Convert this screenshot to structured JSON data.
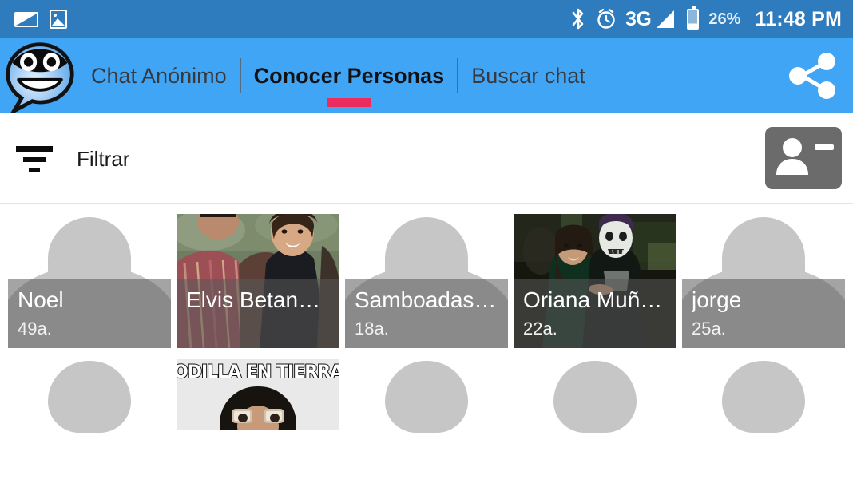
{
  "status_bar": {
    "background_color": "#2e7cbe",
    "left_icons": [
      {
        "name": "battery-notification-icon"
      },
      {
        "name": "screenshot-image-icon"
      }
    ],
    "right_icons": [
      {
        "name": "bluetooth-icon",
        "glyph": "ᛗ"
      },
      {
        "name": "alarm-clock-icon",
        "glyph": "⏱"
      }
    ],
    "network": "3G",
    "battery_percent": "26%",
    "time": "11:48 PM"
  },
  "app_bar": {
    "background_color": "#41a5f5",
    "logo_name": "chat-anonimo-logo",
    "share_icon": "share-icon",
    "indicator_color": "#ec2b5f",
    "tabs": [
      {
        "label": "Chat Anónimo",
        "active": false
      },
      {
        "label": "Conocer Personas",
        "active": true
      },
      {
        "label": "Buscar chat",
        "active": false
      }
    ]
  },
  "filter_bar": {
    "filter_icon": "filter-icon",
    "filter_label": "Filtrar",
    "contacts_button_icon": "contact-card-remove-icon",
    "contacts_button_color": "#6b6b6b"
  },
  "people_grid": {
    "row1": [
      {
        "name": "Noel",
        "age": "49a.",
        "photo": "placeholder"
      },
      {
        "name": "Elvis Betan…",
        "age": "",
        "photo": "couple-man-striped-shirt"
      },
      {
        "name": "Samboadas…",
        "age": "18a.",
        "photo": "placeholder"
      },
      {
        "name": "Oriana Muñ…",
        "age": "22a.",
        "photo": "couple-night-dark"
      },
      {
        "name": "jorge",
        "age": "25a.",
        "photo": "placeholder"
      }
    ],
    "row2": [
      {
        "photo": "placeholder",
        "caption": ""
      },
      {
        "photo": "meme-image",
        "caption": "ODILLA EN TIERRA YA"
      },
      {
        "photo": "placeholder",
        "caption": ""
      },
      {
        "photo": "placeholder",
        "caption": ""
      },
      {
        "photo": "placeholder",
        "caption": ""
      }
    ]
  }
}
